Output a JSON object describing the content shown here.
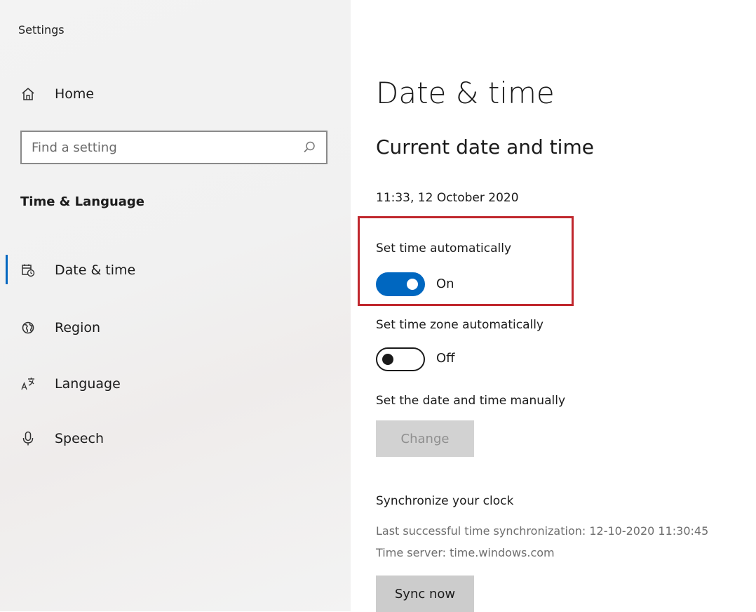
{
  "window": {
    "title": "Settings"
  },
  "sidebar": {
    "home": {
      "label": "Home",
      "icon": "home-icon"
    },
    "search": {
      "placeholder": "Find a setting",
      "icon": "search-icon"
    },
    "section_heading": "Time & Language",
    "items": [
      {
        "label": "Date & time",
        "icon": "calendar-clock-icon",
        "selected": true
      },
      {
        "label": "Region",
        "icon": "globe-icon",
        "selected": false
      },
      {
        "label": "Language",
        "icon": "language-icon",
        "selected": false
      },
      {
        "label": "Speech",
        "icon": "microphone-icon",
        "selected": false
      }
    ]
  },
  "main": {
    "title": "Date & time",
    "current_heading": "Current date and time",
    "current_value": "11:33, 12 October 2020",
    "set_time_auto": {
      "label": "Set time automatically",
      "state": "On",
      "enabled": true
    },
    "set_zone_auto": {
      "label": "Set time zone automatically",
      "state": "Off",
      "enabled": false
    },
    "manual": {
      "label": "Set the date and time manually",
      "button": "Change"
    },
    "sync": {
      "heading": "Synchronize your clock",
      "last_sync": "Last successful time synchronization: 12-10-2020 11:30:45",
      "server": "Time server: time.windows.com",
      "button": "Sync now"
    }
  },
  "colors": {
    "accent": "#0067c0",
    "highlight": "#c0272d"
  }
}
